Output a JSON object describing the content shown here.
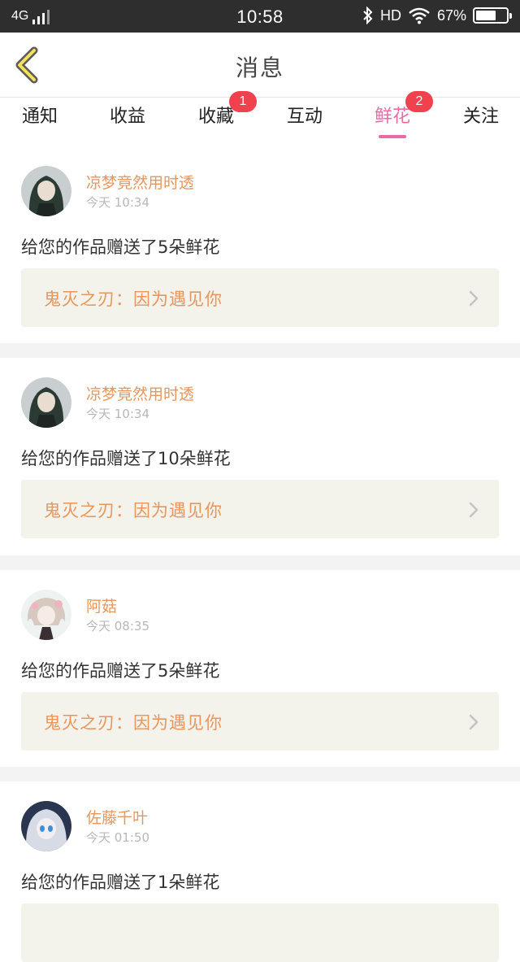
{
  "status": {
    "network": "4G",
    "time": "10:58",
    "hd": "HD",
    "battery": "67%",
    "battery_level": 0.67
  },
  "header": {
    "back_icon": "chevron-left-icon",
    "title": "消息"
  },
  "tabs": [
    {
      "label": "通知",
      "badge": "",
      "active": false
    },
    {
      "label": "收益",
      "badge": "",
      "active": false
    },
    {
      "label": "收藏",
      "badge": "1",
      "active": false
    },
    {
      "label": "互动",
      "badge": "",
      "active": false
    },
    {
      "label": "鲜花",
      "badge": "2",
      "active": true
    },
    {
      "label": "关注",
      "badge": "",
      "active": false
    }
  ],
  "colors": {
    "accent": "#e86ba6",
    "name": "#e8965c",
    "badge": "#f0414e",
    "work_bg": "#f3f2eb"
  },
  "messages": [
    {
      "user": "凉梦竟然用时透",
      "time": "今天 10:34",
      "text": "给您的作品赠送了5朵鲜花",
      "work": "鬼灭之刃：因为遇见你",
      "avatar": "avatar-dark-hair"
    },
    {
      "user": "凉梦竟然用时透",
      "time": "今天 10:34",
      "text": "给您的作品赠送了10朵鲜花",
      "work": "鬼灭之刃：因为遇见你",
      "avatar": "avatar-dark-hair"
    },
    {
      "user": "阿菇",
      "time": "今天 08:35",
      "text": "给您的作品赠送了5朵鲜花",
      "work": "鬼灭之刃：因为遇见你",
      "avatar": "avatar-pastel"
    },
    {
      "user": "佐藤千叶",
      "time": "今天 01:50",
      "text": "给您的作品赠送了1朵鲜花",
      "work": "",
      "avatar": "avatar-blue-eyes"
    }
  ]
}
